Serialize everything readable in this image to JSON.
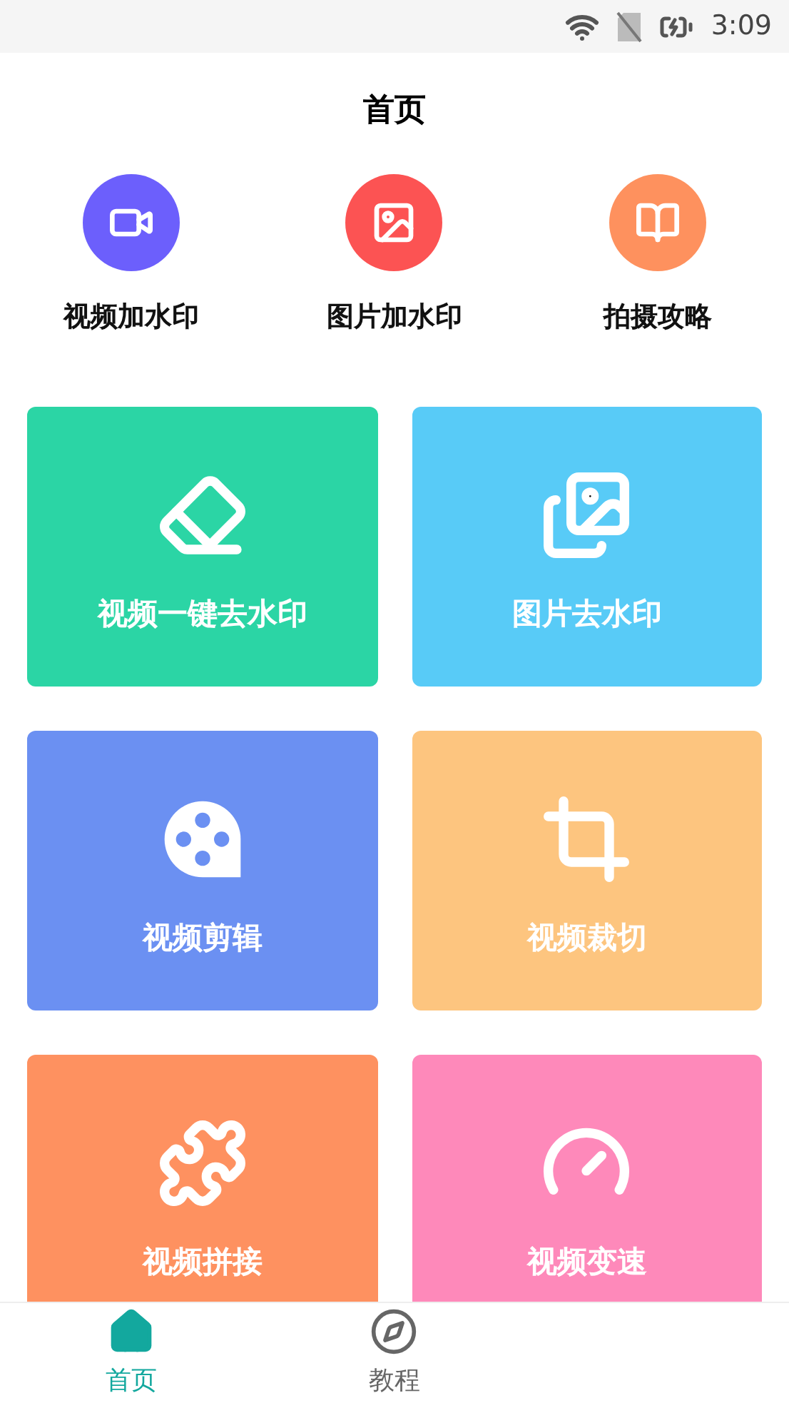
{
  "status_bar": {
    "time": "3:09"
  },
  "header": {
    "title": "首页"
  },
  "quick_actions": [
    {
      "label": "视频加水印",
      "color": "#6c5ffc"
    },
    {
      "label": "图片加水印",
      "color": "#fc5353"
    },
    {
      "label": "拍摄攻略",
      "color": "#fe915e"
    }
  ],
  "tools": [
    {
      "label": "视频一键去水印",
      "color": "#2bd5a5"
    },
    {
      "label": "图片去水印",
      "color": "#58cbf7"
    },
    {
      "label": "视频剪辑",
      "color": "#6b90f2"
    },
    {
      "label": "视频裁切",
      "color": "#fdc57f"
    },
    {
      "label": "视频拼接",
      "color": "#fe9160"
    },
    {
      "label": "视频变速",
      "color": "#fe89ba"
    }
  ],
  "tab_bar": [
    {
      "label": "首页",
      "selected": true
    },
    {
      "label": "教程",
      "selected": false
    }
  ]
}
